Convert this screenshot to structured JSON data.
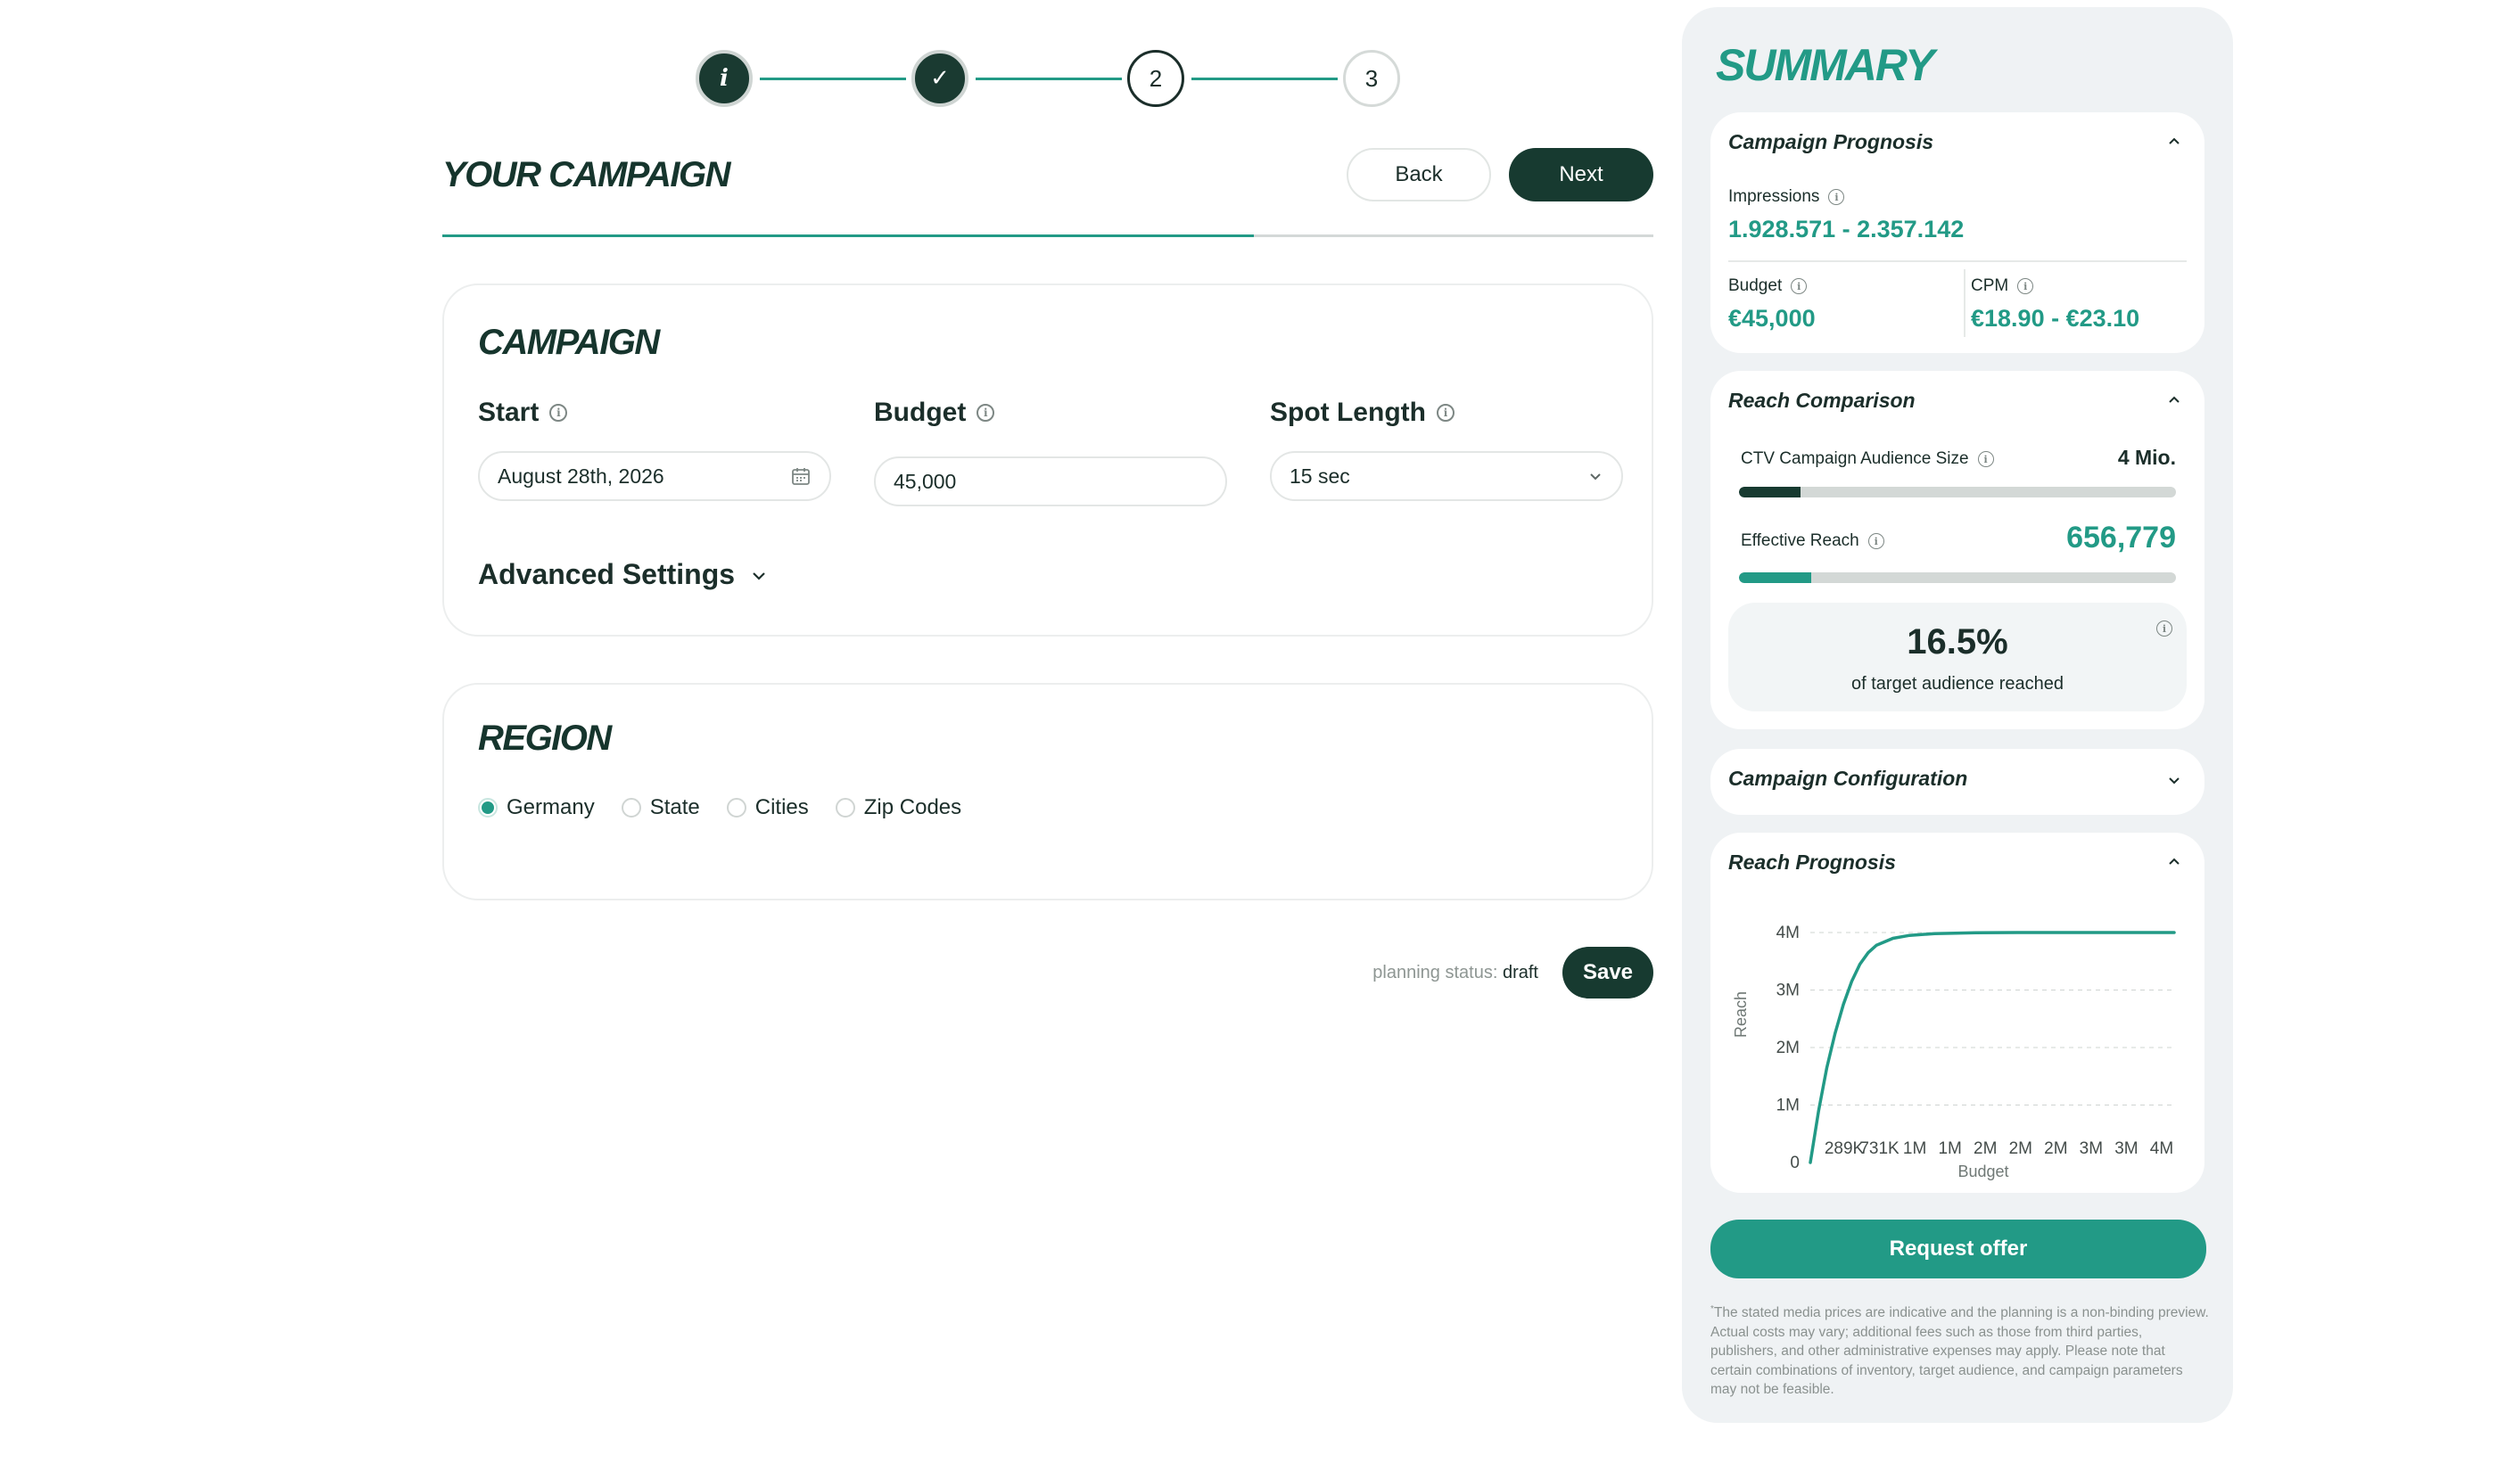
{
  "stepper": {
    "steps": [
      {
        "label": "i",
        "state": "info"
      },
      {
        "label": "✓",
        "state": "done"
      },
      {
        "label": "2",
        "state": "current"
      },
      {
        "label": "3",
        "state": "upcoming"
      }
    ]
  },
  "header": {
    "title": "YOUR CAMPAIGN",
    "back_label": "Back",
    "next_label": "Next",
    "progress": 0.67
  },
  "campaign": {
    "title": "CAMPAIGN",
    "start": {
      "label": "Start",
      "value": "August 28th, 2026"
    },
    "budget": {
      "label": "Budget",
      "value": "45,000"
    },
    "spot_length": {
      "label": "Spot Length",
      "value": "15 sec"
    },
    "advanced_label": "Advanced Settings"
  },
  "region": {
    "title": "REGION",
    "options": [
      {
        "label": "Germany",
        "selected": true
      },
      {
        "label": "State",
        "selected": false
      },
      {
        "label": "Cities",
        "selected": false
      },
      {
        "label": "Zip Codes",
        "selected": false
      }
    ]
  },
  "footer": {
    "status_label": "planning status:",
    "status_value": "draft",
    "save_label": "Save"
  },
  "summary": {
    "title": "SUMMARY",
    "prognosis": {
      "title": "Campaign Prognosis",
      "impressions_label": "Impressions",
      "impressions_value": "1.928.571 - 2.357.142",
      "budget_label": "Budget",
      "budget_value": "€45,000",
      "cpm_label": "CPM",
      "cpm_value": "€18.90 - €23.10"
    },
    "reach": {
      "title": "Reach Comparison",
      "audience_label": "CTV Campaign Audience Size",
      "audience_value": "4 Mio.",
      "audience_fill": 0.14,
      "effective_label": "Effective Reach",
      "effective_value": "656,779",
      "effective_fill": 0.165,
      "percent": "16.5%",
      "percent_caption": "of target audience reached"
    },
    "configuration": {
      "title": "Campaign Configuration"
    },
    "reach_prognosis": {
      "title": "Reach Prognosis"
    },
    "offer_label": "Request offer",
    "disclaimer_mark": "*",
    "disclaimer": "The stated media prices are indicative and the planning is a non-binding preview. Actual costs may vary; additional fees such as those from third parties, publishers, and other administrative expenses may apply. Please note that certain combinations of inventory, target audience, and campaign parameters may not be feasible."
  },
  "colors": {
    "brand_dark": "#173a30",
    "accent": "#229a86",
    "panel_bg": "#eff2f4"
  },
  "chart_data": {
    "type": "line",
    "xlabel": "Budget",
    "ylabel": "Reach",
    "x_tick_labels": [
      "289K",
      "731K",
      "1M",
      "1M",
      "2M",
      "2M",
      "2M",
      "3M",
      "3M",
      "4M"
    ],
    "y_tick_labels": [
      "0",
      "1M",
      "2M",
      "3M",
      "4M"
    ],
    "y_ticks": [
      0,
      1000000,
      2000000,
      3000000,
      4000000
    ],
    "ylim": [
      0,
      4000000
    ],
    "xlim": [
      0,
      4400000
    ],
    "grid": true,
    "series": [
      {
        "x": [
          0,
          100000,
          200000,
          300000,
          400000,
          500000,
          600000,
          700000,
          800000,
          1000000,
          1200000,
          1500000,
          2000000,
          2500000,
          3000000,
          3500000,
          4000000,
          4400000
        ],
        "y": [
          0,
          900000,
          1650000,
          2250000,
          2750000,
          3150000,
          3450000,
          3650000,
          3780000,
          3900000,
          3950000,
          3980000,
          3995000,
          4000000,
          4000000,
          4000000,
          4000000,
          4000000
        ]
      }
    ]
  }
}
